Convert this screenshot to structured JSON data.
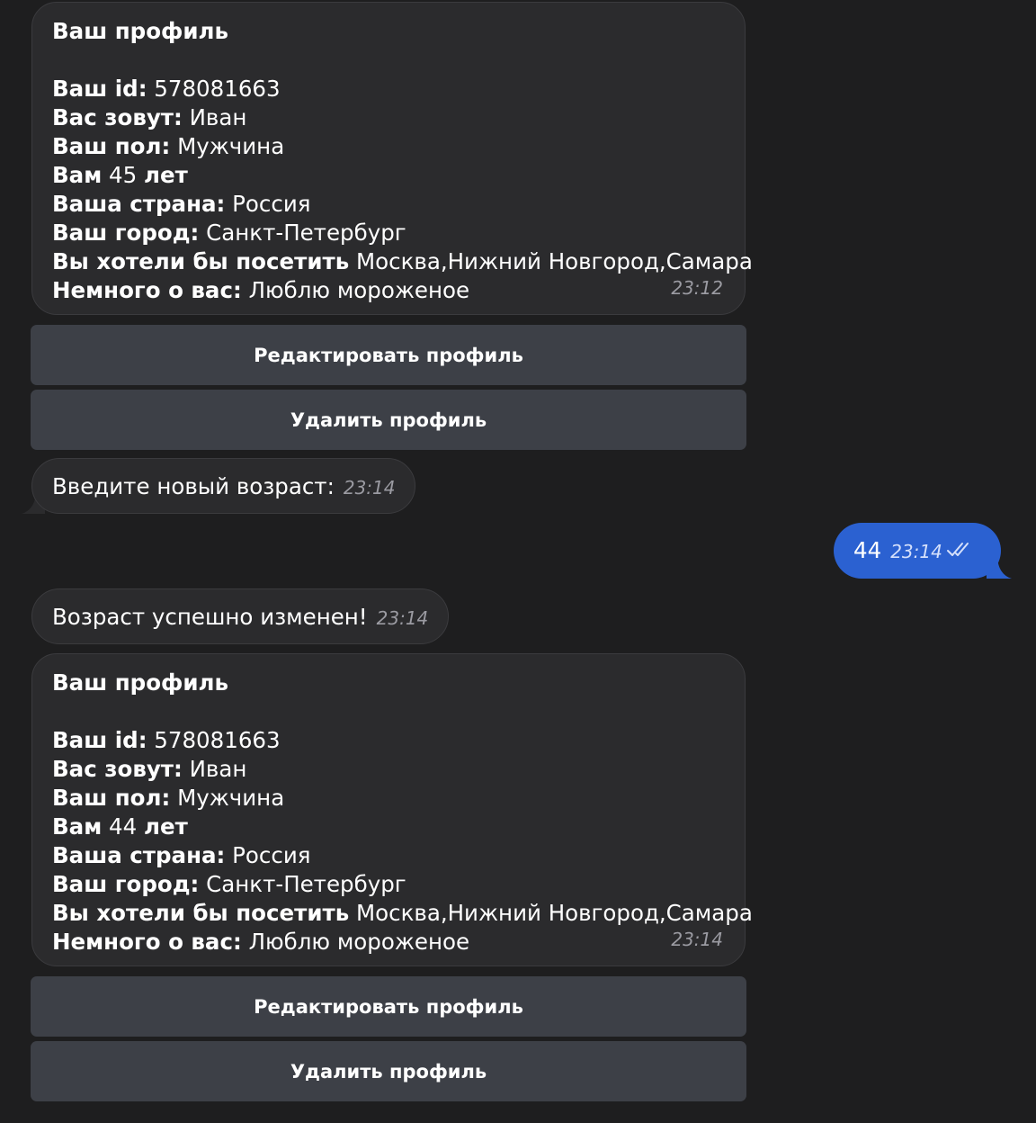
{
  "profile1": {
    "title": "Ваш профиль",
    "id_label": "Ваш id:",
    "id_value": "578081663",
    "name_label": "Вас зовут:",
    "name_value": "Иван",
    "gender_label": "Ваш пол:",
    "gender_value": "Мужчина",
    "age_prefix": "Вам",
    "age_value": "45",
    "age_suffix": "лет",
    "country_label": "Ваша страна:",
    "country_value": "Россия",
    "city_label": "Ваш город:",
    "city_value": "Санкт-Петербург",
    "visit_label": "Вы хотели бы посетить",
    "visit_value": "Москва,Нижний Новгород,Самара",
    "about_label": "Немного о вас:",
    "about_value": "Люблю мороженое",
    "time": "23:12"
  },
  "keyboard1": {
    "edit_label": "Редактировать профиль",
    "delete_label": "Удалить профиль"
  },
  "prompt_msg": {
    "text": "Введите новый возраст:",
    "time": "23:14"
  },
  "user_msg": {
    "text": "44",
    "time": "23:14",
    "status_icon": "double-check-icon"
  },
  "success_msg": {
    "text": "Возраст успешно изменен!",
    "time": "23:14"
  },
  "profile2": {
    "title": "Ваш профиль",
    "id_label": "Ваш id:",
    "id_value": "578081663",
    "name_label": "Вас зовут:",
    "name_value": "Иван",
    "gender_label": "Ваш пол:",
    "gender_value": "Мужчина",
    "age_prefix": "Вам",
    "age_value": "44",
    "age_suffix": "лет",
    "country_label": "Ваша страна:",
    "country_value": "Россия",
    "city_label": "Ваш город:",
    "city_value": "Санкт-Петербург",
    "visit_label": "Вы хотели бы посетить",
    "visit_value": "Москва,Нижний Новгород,Самара",
    "about_label": "Немного о вас:",
    "about_value": "Люблю мороженое",
    "time": "23:14"
  },
  "keyboard2": {
    "edit_label": "Редактировать профиль",
    "delete_label": "Удалить профиль"
  },
  "colors": {
    "background": "#1e1e1f",
    "incoming_bubble": "#2b2b2d",
    "outgoing_bubble": "#2b61d1",
    "keyboard_button": "#3d4047",
    "timestamp": "#9b9ba2"
  }
}
